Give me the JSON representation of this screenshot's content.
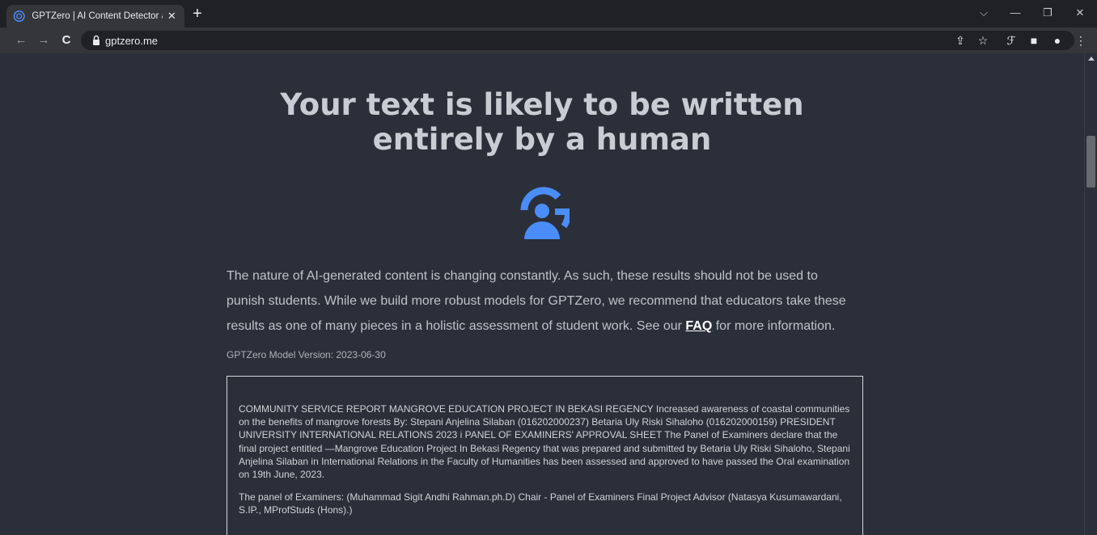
{
  "browser": {
    "tab_title": "GPTZero | AI Content Detector and More",
    "tab_close": "✕",
    "new_tab": "+",
    "url": "gptzero.me",
    "window_controls": {
      "dropdown": "⌵",
      "minimize": "—",
      "restore": "❐",
      "close": "✕"
    },
    "nav": {
      "back": "←",
      "forward": "→",
      "reload": "C"
    },
    "toolbar_icons": {
      "share": "⇪",
      "bookmark": "☆",
      "extension": "ℱ",
      "sidepanel": "■",
      "profile": "●",
      "menu": "⋮"
    },
    "accent": "#4a8df8"
  },
  "result": {
    "headline": "Your text is likely to be written entirely by a human",
    "icon": "human-person-icon",
    "notice_before_link": "The nature of AI-generated content is changing constantly. As such, these results should not be used to punish students. While we build more robust models for GPTZero, we recommend that educators take these results as one of many pieces in a holistic assessment of student work. See our ",
    "faq_label": "FAQ",
    "notice_after_link": " for more information.",
    "model_version": "GPTZero Model Version: 2023-06-30"
  },
  "submitted_text": {
    "paragraphs": [
      "COMMUNITY SERVICE REPORT MANGROVE EDUCATION PROJECT IN BEKASI REGENCY Increased awareness of coastal communities on the benefits of mangrove forests By: Stepani Anjelina Silaban (016202000237) Betaria Uly Riski Sihaloho (016202000159) PRESIDENT UNIVERSITY INTERNATIONAL RELATIONS 2023 i PANEL OF EXAMINERS' APPROVAL SHEET The Panel of Examiners declare that the final project entitled —Mangrove Education Project In Bekasi Regency that was prepared and submitted by Betaria Uly Riski Sihaloho, Stepani Anjelina Silaban in International Relations in the Faculty of Humanities has been assessed and approved to have passed the Oral examination on 19th June, 2023.",
      "The panel of Examiners: (Muhammad Sigit Andhi Rahman.ph.D) Chair - Panel of Examiners Final Project Advisor (Natasya Kusumawardani, S.IP., MProfStuds (Hons).)"
    ]
  }
}
